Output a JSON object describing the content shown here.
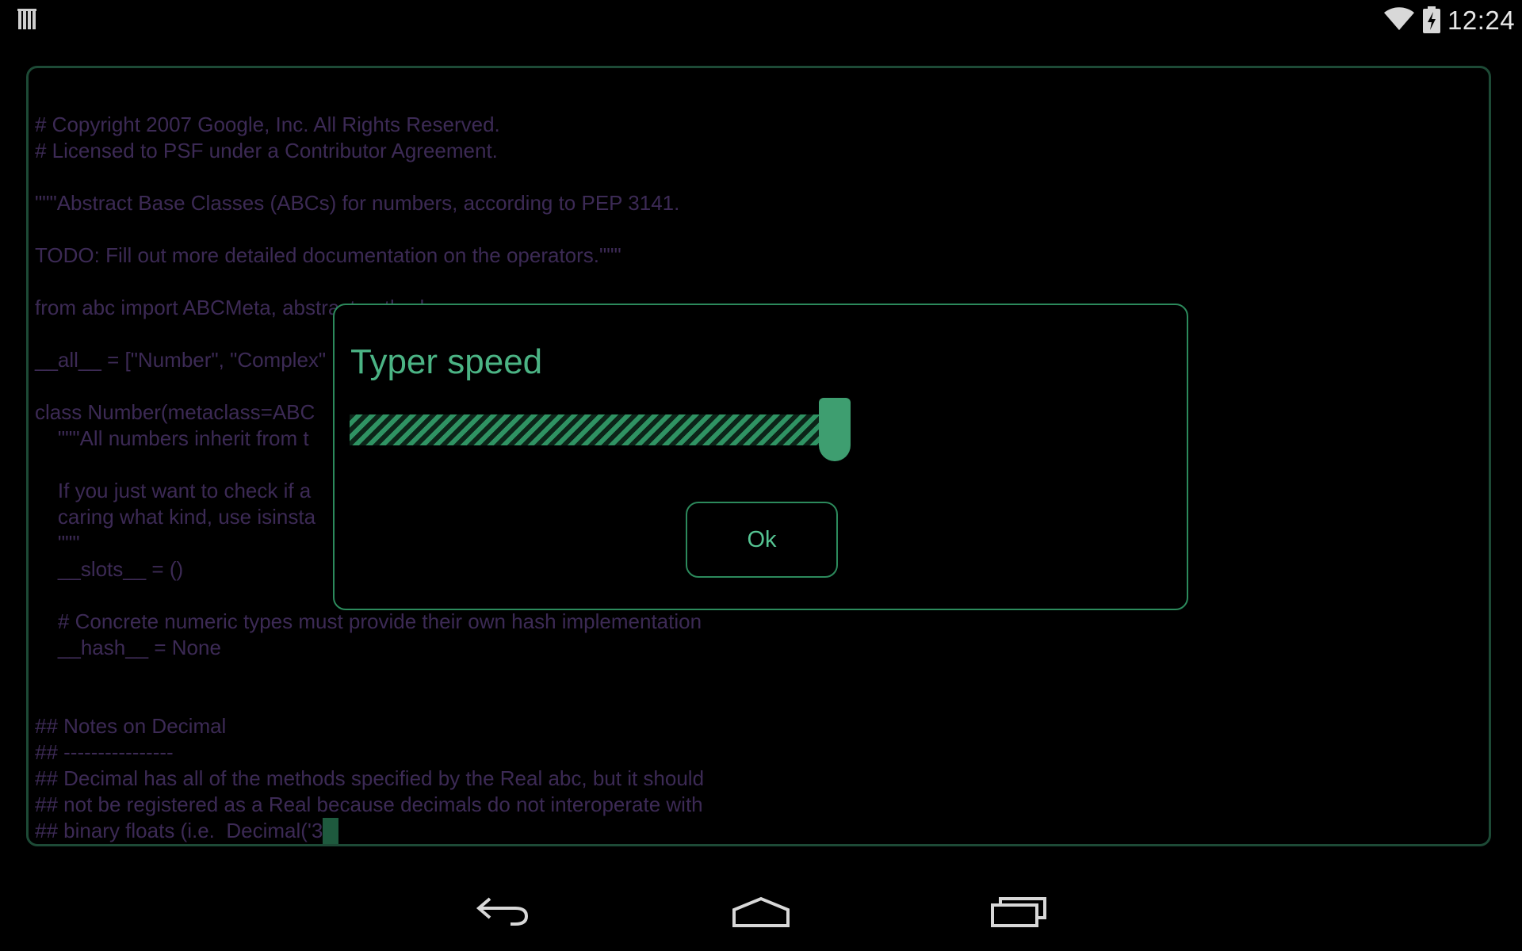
{
  "status_bar": {
    "time": "12:24",
    "icons": [
      "notification-icon",
      "wifi-icon",
      "battery-charging-icon"
    ]
  },
  "editor": {
    "lines": [
      "# Copyright 2007 Google, Inc. All Rights Reserved.",
      "# Licensed to PSF under a Contributor Agreement.",
      "",
      "\"\"\"Abstract Base Classes (ABCs) for numbers, according to PEP 3141.",
      "",
      "TODO: Fill out more detailed documentation on the operators.\"\"\"",
      "",
      "from abc import ABCMeta, abstractmethod",
      "",
      "__all__ = [\"Number\", \"Complex\"",
      "",
      "class Number(metaclass=ABC",
      "    \"\"\"All numbers inherit from t",
      "",
      "    If you just want to check if a",
      "    caring what kind, use isinsta",
      "    \"\"\"",
      "    __slots__ = ()",
      "",
      "    # Concrete numeric types must provide their own hash implementation",
      "    __hash__ = None",
      "",
      "",
      "## Notes on Decimal",
      "## ----------------",
      "## Decimal has all of the methods specified by the Real abc, but it should",
      "## not be registered as a Real because decimals do not interoperate with",
      "## binary floats (i.e.  Decimal('3"
    ],
    "colors": {
      "text": "#3c2a55",
      "frame": "#1d4a36",
      "cursor": "#1e5a3e"
    }
  },
  "dialog": {
    "title": "Typer speed",
    "slider_value": 1.0,
    "ok_label": "Ok",
    "accent_color": "#4bb384"
  },
  "nav_bar": {
    "buttons": [
      "back-icon",
      "home-icon",
      "recent-apps-icon"
    ]
  }
}
